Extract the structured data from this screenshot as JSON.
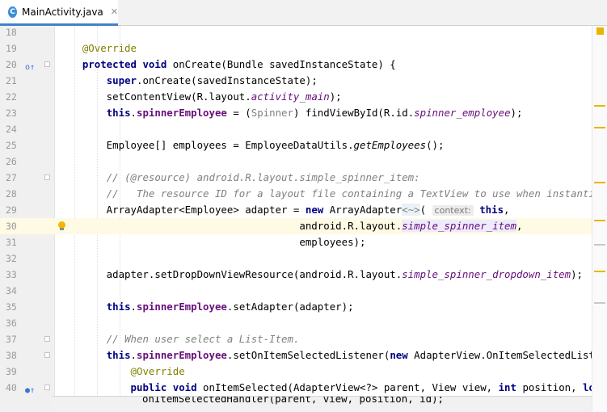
{
  "tab": {
    "icon_letter": "C",
    "title": "MainActivity.java",
    "close": "✕"
  },
  "context_hint": "context:",
  "lines": [
    {
      "n": "18"
    },
    {
      "n": "19",
      "tokens": [
        {
          "t": "    "
        },
        {
          "t": "@Override",
          "c": "ann"
        }
      ]
    },
    {
      "n": "20",
      "marker": "o↑",
      "fold": true,
      "tokens": [
        {
          "t": "    "
        },
        {
          "t": "protected void",
          "c": "kw"
        },
        {
          "t": " onCreate(Bundle savedInstanceState) {"
        }
      ]
    },
    {
      "n": "21",
      "tokens": [
        {
          "t": "        "
        },
        {
          "t": "super",
          "c": "kw"
        },
        {
          "t": ".onCreate(savedInstanceState);"
        }
      ]
    },
    {
      "n": "22",
      "tokens": [
        {
          "t": "        setContentView(R.layout."
        },
        {
          "t": "activity_main",
          "c": "it"
        },
        {
          "t": ");"
        }
      ]
    },
    {
      "n": "23",
      "tokens": [
        {
          "t": "        "
        },
        {
          "t": "this",
          "c": "kw"
        },
        {
          "t": "."
        },
        {
          "t": "spinnerEmployee",
          "c": "fld"
        },
        {
          "t": " = ("
        },
        {
          "t": "Spinner",
          "c": "gray"
        },
        {
          "t": ") findViewById(R.id."
        },
        {
          "t": "spinner_employee",
          "c": "it"
        },
        {
          "t": ");"
        }
      ]
    },
    {
      "n": "24"
    },
    {
      "n": "25",
      "tokens": [
        {
          "t": "        Employee[] employees = EmployeeDataUtils."
        },
        {
          "t": "getEmployees",
          "c": "st"
        },
        {
          "t": "();"
        }
      ]
    },
    {
      "n": "26"
    },
    {
      "n": "27",
      "fold": true,
      "tokens": [
        {
          "t": "        "
        },
        {
          "t": "// (@resource) android.R.layout.simple_spinner_item:",
          "c": "cm"
        }
      ]
    },
    {
      "n": "28",
      "tokens": [
        {
          "t": "        "
        },
        {
          "t": "//   The resource ID for a layout file containing a TextView to use when instantiating views.",
          "c": "cm"
        }
      ]
    },
    {
      "n": "29",
      "tokens": [
        {
          "t": "        ArrayAdapter<Employee> adapter = "
        },
        {
          "t": "new",
          "c": "kw"
        },
        {
          "t": " ArrayAdapter"
        },
        {
          "t": "<~>",
          "c": "fold-op"
        },
        {
          "t": "( "
        },
        {
          "hint": "context_hint"
        },
        {
          "t": " "
        },
        {
          "t": "this",
          "c": "kw"
        },
        {
          "t": ","
        }
      ]
    },
    {
      "n": "30",
      "current": true,
      "bulb": true,
      "tokens": [
        {
          "t": "                                        android.R.layout."
        },
        {
          "t": "simple_spinner_item",
          "c": "it hl"
        },
        {
          "t": ","
        }
      ]
    },
    {
      "n": "31",
      "tokens": [
        {
          "t": "                                        employees);"
        }
      ]
    },
    {
      "n": "32"
    },
    {
      "n": "33",
      "tokens": [
        {
          "t": "        adapter.setDropDownViewResource(android.R.layout."
        },
        {
          "t": "simple_spinner_dropdown_item",
          "c": "it"
        },
        {
          "t": ");"
        }
      ]
    },
    {
      "n": "34"
    },
    {
      "n": "35",
      "tokens": [
        {
          "t": "        "
        },
        {
          "t": "this",
          "c": "kw"
        },
        {
          "t": "."
        },
        {
          "t": "spinnerEmployee",
          "c": "fld"
        },
        {
          "t": ".setAdapter(adapter);"
        }
      ]
    },
    {
      "n": "36"
    },
    {
      "n": "37",
      "fold": true,
      "tokens": [
        {
          "t": "        "
        },
        {
          "t": "// When user select a List-Item.",
          "c": "cm"
        }
      ]
    },
    {
      "n": "38",
      "fold": true,
      "tokens": [
        {
          "t": "        "
        },
        {
          "t": "this",
          "c": "kw"
        },
        {
          "t": "."
        },
        {
          "t": "spinnerEmployee",
          "c": "fld"
        },
        {
          "t": ".setOnItemSelectedListener("
        },
        {
          "t": "new",
          "c": "kw"
        },
        {
          "t": " AdapterView.OnItemSelectedListener() {"
        }
      ]
    },
    {
      "n": "39",
      "tokens": [
        {
          "t": "            "
        },
        {
          "t": "@Override",
          "c": "ann"
        }
      ]
    },
    {
      "n": "40",
      "marker": "●↑",
      "fold": true,
      "tokens": [
        {
          "t": "            "
        },
        {
          "t": "public void",
          "c": "kw"
        },
        {
          "t": " onItemSelected(AdapterView<?> parent, View view, "
        },
        {
          "t": "int",
          "c": "kw"
        },
        {
          "t": " position, "
        },
        {
          "t": "long",
          "c": "kw"
        },
        {
          "t": " id) {"
        }
      ]
    }
  ],
  "popup_line": "onItemSelectedHandler(parent, view, position, id);",
  "colors": {
    "keyword": "#000080",
    "field": "#660e7a",
    "annotation": "#808000",
    "comment": "#808080",
    "current_line": "#fffae3",
    "warning": "#e9b500"
  }
}
